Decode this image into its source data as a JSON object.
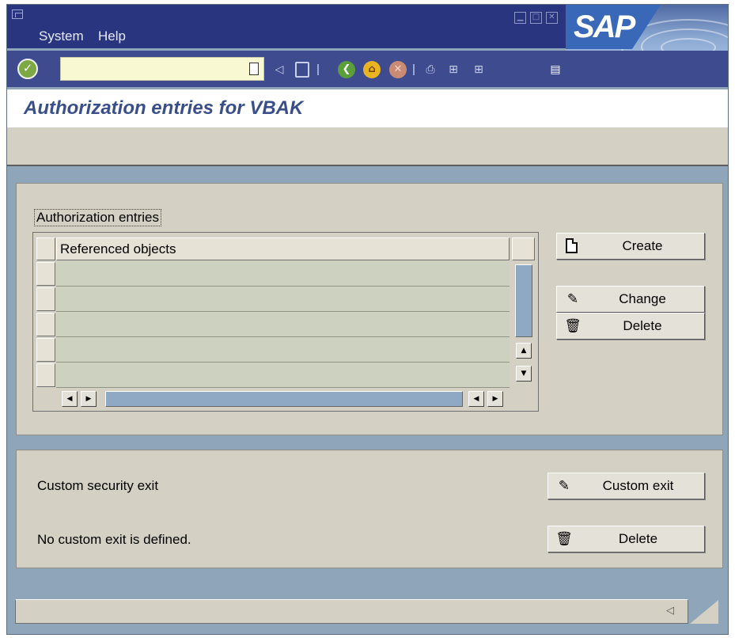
{
  "menu": {
    "items": [
      {
        "label": "System",
        "underline": "y"
      },
      {
        "label": "Help",
        "underline": "H"
      }
    ]
  },
  "window_controls": {
    "minimize": "minimize-icon",
    "maximize": "maximize-icon",
    "close": "close-icon"
  },
  "brand": {
    "logo_text": "SAP",
    "accent": "#3a68b8"
  },
  "toolbar": {
    "command_field": {
      "value": "",
      "placeholder": ""
    },
    "icons": [
      "enter-icon",
      "history-icon",
      "back-arrow-icon",
      "save-icon",
      "back-icon",
      "exit-icon",
      "cancel-icon",
      "print-icon",
      "find-icon",
      "find-next-icon",
      "layout-menu-icon"
    ]
  },
  "header": {
    "title": "Authorization entries for VBAK"
  },
  "authorization": {
    "group_label": "Authorization entries",
    "table": {
      "columns": [
        "Referenced objects"
      ],
      "rows": [
        "",
        "",
        "",
        "",
        ""
      ]
    },
    "buttons": {
      "create": "Create",
      "change": "Change",
      "delete": "Delete"
    }
  },
  "custom_exit": {
    "label": "Custom security exit",
    "status": "No custom exit is defined.",
    "buttons": {
      "custom_exit": "Custom exit",
      "delete": "Delete"
    }
  },
  "statusbar": {
    "message": ""
  },
  "colors": {
    "menubar": "#2a3580",
    "toolbar": "#3f4b8f",
    "frame": "#8fa5ba",
    "panel": "#d4d0c4",
    "title_text": "#3a4f8a"
  }
}
